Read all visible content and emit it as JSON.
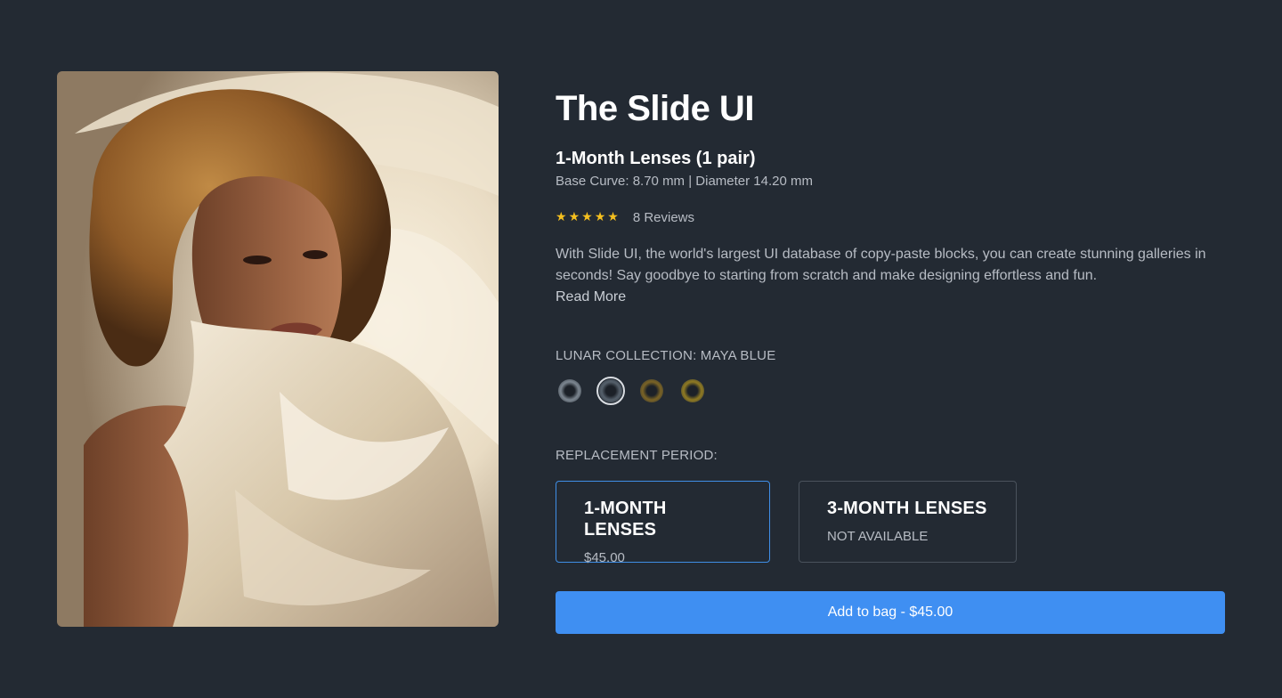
{
  "product": {
    "title": "The Slide UI",
    "subtitle": "1-Month Lenses (1 pair)",
    "specs": "Base Curve: 8.70 mm | Diameter 14.20 mm",
    "rating": 5,
    "reviews": "8 Reviews",
    "description": "With Slide UI, the world's largest UI database of copy-paste blocks, you can create stunning galleries in seconds! Say goodbye to starting from scratch and make designing effortless and fun.",
    "read_more": "Read More",
    "image_icon": "portrait-photo"
  },
  "collection": {
    "label": "LUNAR COLLECTION: MAYA BLUE",
    "selected_index": 1,
    "swatches": [
      {
        "name": "grey",
        "color": "#7c8690"
      },
      {
        "name": "maya-blue",
        "color": "#55606b"
      },
      {
        "name": "hazel",
        "color": "#7a6325"
      },
      {
        "name": "gold",
        "color": "#8f7a22"
      }
    ]
  },
  "replacement": {
    "label": "REPLACEMENT PERIOD:",
    "options": [
      {
        "title": "1-MONTH LENSES",
        "sub": "$45.00",
        "selected": true
      },
      {
        "title": "3-MONTH LENSES",
        "sub": "NOT AVAILABLE",
        "selected": false
      }
    ]
  },
  "cta": {
    "label": "Add to bag - $45.00",
    "color": "#3f8ff2"
  },
  "colors": {
    "background": "#232a33",
    "star": "#f5c01f",
    "accent_border": "#3f8ee6"
  }
}
